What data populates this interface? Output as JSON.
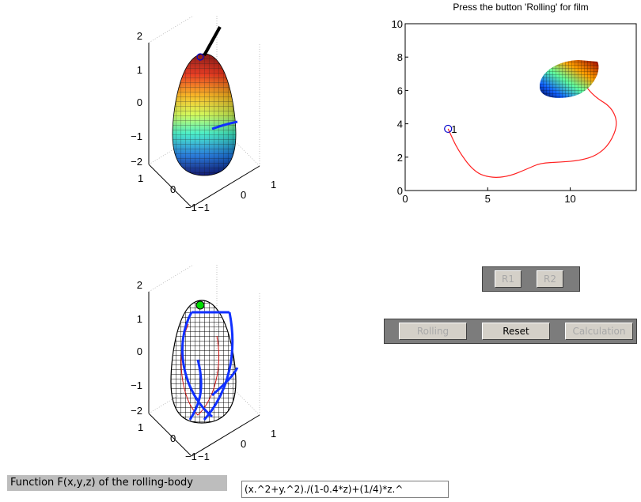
{
  "plot_title": "Press the button 'Rolling' for film",
  "trajectory_plot": {
    "x_ticks": [
      "0",
      "5",
      "10"
    ],
    "y_ticks": [
      "0",
      "2",
      "4",
      "6",
      "8",
      "10"
    ],
    "marker_label": "1",
    "colors": {
      "path": "#ff2020",
      "marker": "#0000cc"
    }
  },
  "axes3d_top": {
    "z_ticks": [
      "2",
      "1",
      "0",
      "−1",
      "−2"
    ],
    "x_ticks": [
      "1",
      "0",
      "−1"
    ],
    "y_ticks": [
      "−1",
      "0",
      "1"
    ]
  },
  "axes3d_bottom": {
    "z_ticks": [
      "2",
      "1",
      "0",
      "−1",
      "−2"
    ],
    "x_ticks": [
      "1",
      "0",
      "−1"
    ],
    "y_ticks": [
      "−1",
      "0",
      "1"
    ]
  },
  "buttons": {
    "r1": "R1",
    "r2": "R2",
    "rolling": "Rolling",
    "reset": "Reset",
    "calculation": "Calculation"
  },
  "function_label": "Function F(x,y,z) of the rolling-body",
  "function_input_value": "(x.^2+y.^2)./(1-0.4*z)+(1/4)*z.^"
}
